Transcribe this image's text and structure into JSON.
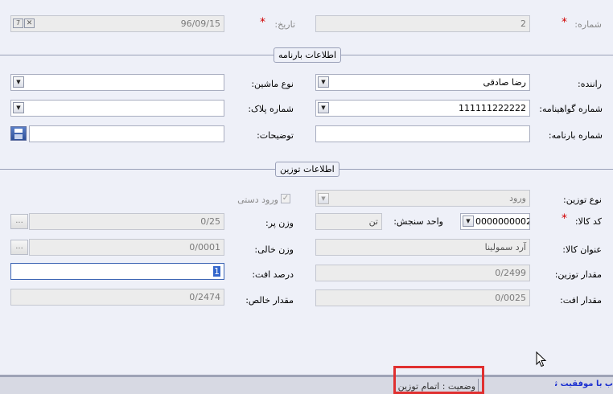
{
  "header": {
    "number_label": "شماره:",
    "number_value": "2",
    "date_label": "تاریخ:",
    "date_value": "96/09/15",
    "required_mark": "*"
  },
  "waybill": {
    "title": "اطلاعات بارنامه",
    "driver_label": "راننده:",
    "driver_value": "رضا صادقی",
    "vehicle_type_label": "نوع ماشین:",
    "vehicle_type_value": "",
    "license_label": "شماره گواهینامه:",
    "license_value": "111111222222",
    "plate_label": "شماره پلاک:",
    "plate_value": "",
    "waybill_no_label": "شماره بارنامه:",
    "waybill_no_value": "",
    "notes_label": "توضیحات:",
    "notes_value": ""
  },
  "weighing": {
    "title": "اطلاعات توزین",
    "type_label": "نوع توزین:",
    "type_value": "ورود",
    "manual_entry_label": "ورود دستی",
    "manual_entry_checked": true,
    "code_label": "کد کالا:",
    "code_value": "0000000002",
    "unit_label": "واحد سنجش:",
    "unit_value": "تن",
    "full_weight_label": "وزن پر:",
    "full_weight_value": "0/25",
    "name_label": "عنوان کالا:",
    "name_value": "آرد سمولینا",
    "empty_weight_label": "وزن خالی:",
    "empty_weight_value": "0/0001",
    "amount_label": "مقدار توزین:",
    "amount_value": "0/2499",
    "loss_pct_label": "درصد افت:",
    "loss_pct_value": "1",
    "loss_label": "مقدار افت:",
    "loss_value": "0/0025",
    "net_label": "مقدار خالص:",
    "net_value": "0/2474",
    "dots": "..."
  },
  "status": {
    "state_text": "وضعیت : اتمام توزین",
    "message": "ب با موفقیت ثبت شد"
  },
  "colors": {
    "required": "#d00000",
    "highlight_box": "#e03030",
    "status_message": "#1a2fd0",
    "selection": "#3366cc"
  }
}
